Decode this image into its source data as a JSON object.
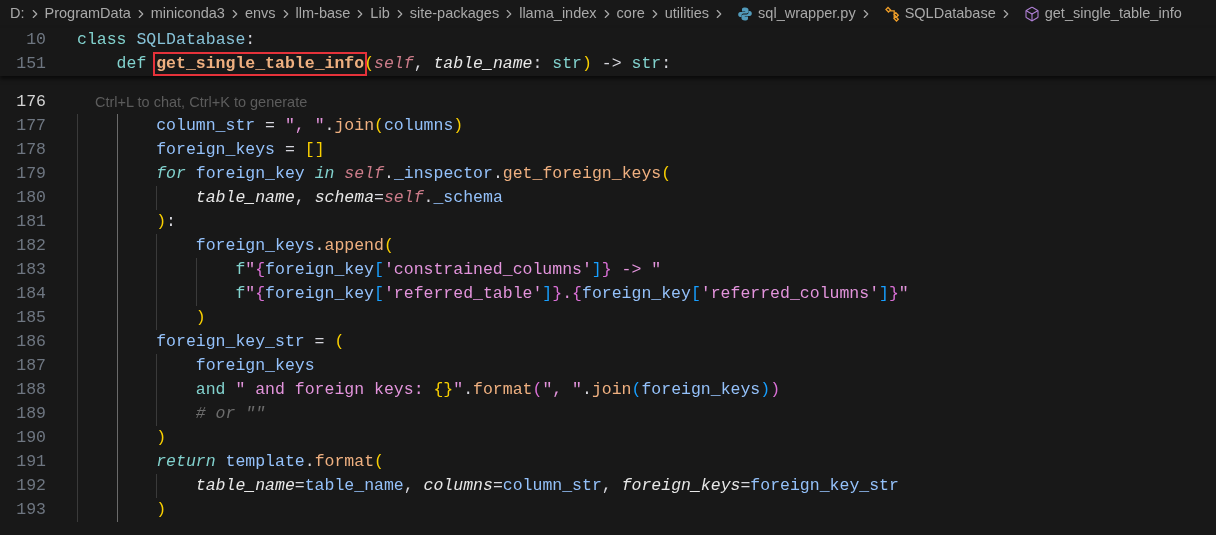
{
  "breadcrumbs": [
    {
      "kind": "folder",
      "text": "D:"
    },
    {
      "kind": "folder",
      "text": "ProgramData"
    },
    {
      "kind": "folder",
      "text": "miniconda3"
    },
    {
      "kind": "folder",
      "text": "envs"
    },
    {
      "kind": "folder",
      "text": "llm-base"
    },
    {
      "kind": "folder",
      "text": "Lib"
    },
    {
      "kind": "folder",
      "text": "site-packages"
    },
    {
      "kind": "folder",
      "text": "llama_index"
    },
    {
      "kind": "folder",
      "text": "core"
    },
    {
      "kind": "folder",
      "text": "utilities"
    },
    {
      "kind": "python_file",
      "text": "sql_wrapper.py"
    },
    {
      "kind": "class",
      "text": "SQLDatabase"
    },
    {
      "kind": "method",
      "text": "get_single_table_info"
    }
  ],
  "sticky_lines": [
    {
      "number": "10",
      "tokens": [
        {
          "kind": "keyword",
          "text": "class"
        },
        {
          "kind": "class_name",
          "text": " SQLDatabase"
        },
        {
          "kind": "plain",
          "text": ":"
        }
      ],
      "children": [
        {
          "number": "151",
          "tokens": [
            {
              "kind": "keyword",
              "text": "def "
            },
            {
              "kind": "function_def",
              "text": "get_single_table_info",
              "boxed": true
            },
            {
              "kind": "bracket1",
              "text": "("
            },
            {
              "kind": "self",
              "text": "self"
            },
            {
              "kind": "plain",
              "text": ", "
            },
            {
              "kind": "param",
              "text": "table_name"
            },
            {
              "kind": "plain",
              "text": ": "
            },
            {
              "kind": "type",
              "text": "str"
            },
            {
              "kind": "bracket1",
              "text": ")"
            },
            {
              "kind": "plain",
              "text": " -> "
            },
            {
              "kind": "type",
              "text": "str"
            },
            {
              "kind": "plain",
              "text": ":"
            }
          ]
        }
      ]
    }
  ],
  "lines": [
    {
      "number": "176",
      "active": true,
      "hint": "Ctrl+L to chat, Ctrl+K to generate"
    },
    {
      "number": "177",
      "active": false,
      "tokens": [
        {
          "kind": "variable",
          "text": "column_str"
        },
        {
          "kind": "plain",
          "text": " = "
        },
        {
          "kind": "string",
          "text": "\", \""
        },
        {
          "kind": "plain",
          "text": "."
        },
        {
          "kind": "call",
          "text": "join"
        },
        {
          "kind": "bracket1",
          "text": "("
        },
        {
          "kind": "variable",
          "text": "columns"
        },
        {
          "kind": "bracket1",
          "text": ")"
        }
      ]
    },
    {
      "number": "178",
      "active": false,
      "tokens": [
        {
          "kind": "variable",
          "text": "foreign_keys"
        },
        {
          "kind": "plain",
          "text": " = "
        },
        {
          "kind": "bracket1",
          "text": "[]"
        }
      ]
    },
    {
      "number": "179",
      "active": false,
      "tokens": [
        {
          "kind": "control",
          "text": "for"
        },
        {
          "kind": "variable",
          "text": " foreign_key "
        },
        {
          "kind": "control",
          "text": "in"
        },
        {
          "kind": "self",
          "text": " self"
        },
        {
          "kind": "plain",
          "text": "."
        },
        {
          "kind": "variable",
          "text": "_inspector"
        },
        {
          "kind": "plain",
          "text": "."
        },
        {
          "kind": "call",
          "text": "get_foreign_keys"
        },
        {
          "kind": "bracket1",
          "text": "("
        }
      ],
      "children": [
        {
          "number": "180",
          "active": false,
          "tokens": [
            {
              "kind": "param",
              "text": "table_name"
            },
            {
              "kind": "plain",
              "text": ", "
            },
            {
              "kind": "param",
              "text": "schema"
            },
            {
              "kind": "plain",
              "text": "="
            },
            {
              "kind": "self",
              "text": "self"
            },
            {
              "kind": "plain",
              "text": "."
            },
            {
              "kind": "variable",
              "text": "_schema"
            }
          ]
        }
      ]
    },
    {
      "number": "181",
      "active": false,
      "tokens": [
        {
          "kind": "bracket1",
          "text": ")"
        },
        {
          "kind": "plain",
          "text": ":"
        }
      ],
      "children": [
        {
          "number": "182",
          "active": false,
          "tokens": [
            {
              "kind": "variable",
              "text": "foreign_keys"
            },
            {
              "kind": "plain",
              "text": "."
            },
            {
              "kind": "call",
              "text": "append"
            },
            {
              "kind": "bracket1",
              "text": "("
            }
          ],
          "children": [
            {
              "number": "183",
              "active": false,
              "tokens": [
                {
                  "kind": "fprefix",
                  "text": "f"
                },
                {
                  "kind": "string",
                  "text": "\""
                },
                {
                  "kind": "bracket2",
                  "text": "{"
                },
                {
                  "kind": "variable",
                  "text": "foreign_key"
                },
                {
                  "kind": "bracket3",
                  "text": "["
                },
                {
                  "kind": "string",
                  "text": "'constrained_columns'"
                },
                {
                  "kind": "bracket3",
                  "text": "]"
                },
                {
                  "kind": "bracket2",
                  "text": "}"
                },
                {
                  "kind": "string",
                  "text": " -> \""
                }
              ]
            },
            {
              "number": "184",
              "active": false,
              "tokens": [
                {
                  "kind": "fprefix",
                  "text": "f"
                },
                {
                  "kind": "string",
                  "text": "\""
                },
                {
                  "kind": "bracket2",
                  "text": "{"
                },
                {
                  "kind": "variable",
                  "text": "foreign_key"
                },
                {
                  "kind": "bracket3",
                  "text": "["
                },
                {
                  "kind": "string",
                  "text": "'referred_table'"
                },
                {
                  "kind": "bracket3",
                  "text": "]"
                },
                {
                  "kind": "bracket2",
                  "text": "}"
                },
                {
                  "kind": "string",
                  "text": "."
                },
                {
                  "kind": "bracket2",
                  "text": "{"
                },
                {
                  "kind": "variable",
                  "text": "foreign_key"
                },
                {
                  "kind": "bracket3",
                  "text": "["
                },
                {
                  "kind": "string",
                  "text": "'referred_columns'"
                },
                {
                  "kind": "bracket3",
                  "text": "]"
                },
                {
                  "kind": "bracket2",
                  "text": "}"
                },
                {
                  "kind": "string",
                  "text": "\""
                }
              ]
            }
          ]
        },
        {
          "number": "185",
          "active": false,
          "tokens": [
            {
              "kind": "bracket1",
              "text": ")"
            }
          ]
        }
      ]
    },
    {
      "number": "186",
      "active": false,
      "tokens": [
        {
          "kind": "variable",
          "text": "foreign_key_str"
        },
        {
          "kind": "plain",
          "text": " = "
        },
        {
          "kind": "bracket1",
          "text": "("
        }
      ],
      "children": [
        {
          "number": "187",
          "active": false,
          "tokens": [
            {
              "kind": "variable",
              "text": "foreign_keys"
            }
          ]
        },
        {
          "number": "188",
          "active": false,
          "tokens": [
            {
              "kind": "keyword",
              "text": "and"
            },
            {
              "kind": "string",
              "text": " \" and foreign keys: "
            },
            {
              "kind": "bracket1",
              "text": "{}"
            },
            {
              "kind": "string",
              "text": "\""
            },
            {
              "kind": "plain",
              "text": "."
            },
            {
              "kind": "call",
              "text": "format"
            },
            {
              "kind": "bracket2",
              "text": "("
            },
            {
              "kind": "string",
              "text": "\", \""
            },
            {
              "kind": "plain",
              "text": "."
            },
            {
              "kind": "call",
              "text": "join"
            },
            {
              "kind": "bracket3",
              "text": "("
            },
            {
              "kind": "variable",
              "text": "foreign_keys"
            },
            {
              "kind": "bracket3",
              "text": ")"
            },
            {
              "kind": "bracket2",
              "text": ")"
            }
          ]
        },
        {
          "number": "189",
          "active": false,
          "tokens": [
            {
              "kind": "comment",
              "text": "# or \"\""
            }
          ]
        }
      ]
    },
    {
      "number": "190",
      "active": false,
      "tokens": [
        {
          "kind": "bracket1",
          "text": ")"
        }
      ]
    },
    {
      "number": "191",
      "active": false,
      "tokens": [
        {
          "kind": "control",
          "text": "return"
        },
        {
          "kind": "variable",
          "text": " template"
        },
        {
          "kind": "plain",
          "text": "."
        },
        {
          "kind": "call",
          "text": "format"
        },
        {
          "kind": "bracket1",
          "text": "("
        }
      ],
      "children": [
        {
          "number": "192",
          "active": false,
          "tokens": [
            {
              "kind": "param",
              "text": "table_name"
            },
            {
              "kind": "plain",
              "text": "="
            },
            {
              "kind": "variable",
              "text": "table_name"
            },
            {
              "kind": "plain",
              "text": ", "
            },
            {
              "kind": "param",
              "text": "columns"
            },
            {
              "kind": "plain",
              "text": "="
            },
            {
              "kind": "variable",
              "text": "column_str"
            },
            {
              "kind": "plain",
              "text": ", "
            },
            {
              "kind": "param",
              "text": "foreign_keys"
            },
            {
              "kind": "plain",
              "text": "="
            },
            {
              "kind": "variable",
              "text": "foreign_key_str"
            }
          ]
        }
      ]
    },
    {
      "number": "193",
      "active": false,
      "tokens": [
        {
          "kind": "bracket1",
          "text": ")"
        }
      ]
    }
  ]
}
